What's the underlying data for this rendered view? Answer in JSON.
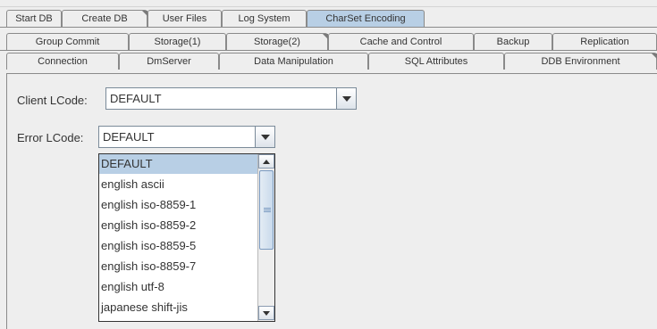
{
  "tabs": {
    "row1": [
      {
        "label": "Start DB"
      },
      {
        "label": "Create DB"
      },
      {
        "label": "User Files"
      },
      {
        "label": "Log System"
      },
      {
        "label": "CharSet Encoding"
      }
    ],
    "row2": [
      {
        "label": "Group Commit"
      },
      {
        "label": "Storage(1)"
      },
      {
        "label": "Storage(2)"
      },
      {
        "label": "Cache and Control"
      },
      {
        "label": "Backup"
      },
      {
        "label": "Replication"
      }
    ],
    "row3": [
      {
        "label": "Connection"
      },
      {
        "label": "DmServer"
      },
      {
        "label": "Data Manipulation"
      },
      {
        "label": "SQL Attributes"
      },
      {
        "label": "DDB Environment"
      }
    ],
    "selected": "CharSet Encoding"
  },
  "form": {
    "client_lcode_label": "Client LCode:",
    "client_lcode_value": "DEFAULT",
    "error_lcode_label": "Error LCode:",
    "error_lcode_value": "DEFAULT"
  },
  "dropdown": {
    "options": [
      "DEFAULT",
      "english ascii",
      "english iso-8859-1",
      "english iso-8859-2",
      "english iso-8859-5",
      "english iso-8859-7",
      "english utf-8",
      "japanese shift-jis"
    ],
    "selected": "DEFAULT"
  },
  "colors": {
    "selected_tab": "#b8cfe5",
    "selected_item": "#b8cfe5"
  }
}
